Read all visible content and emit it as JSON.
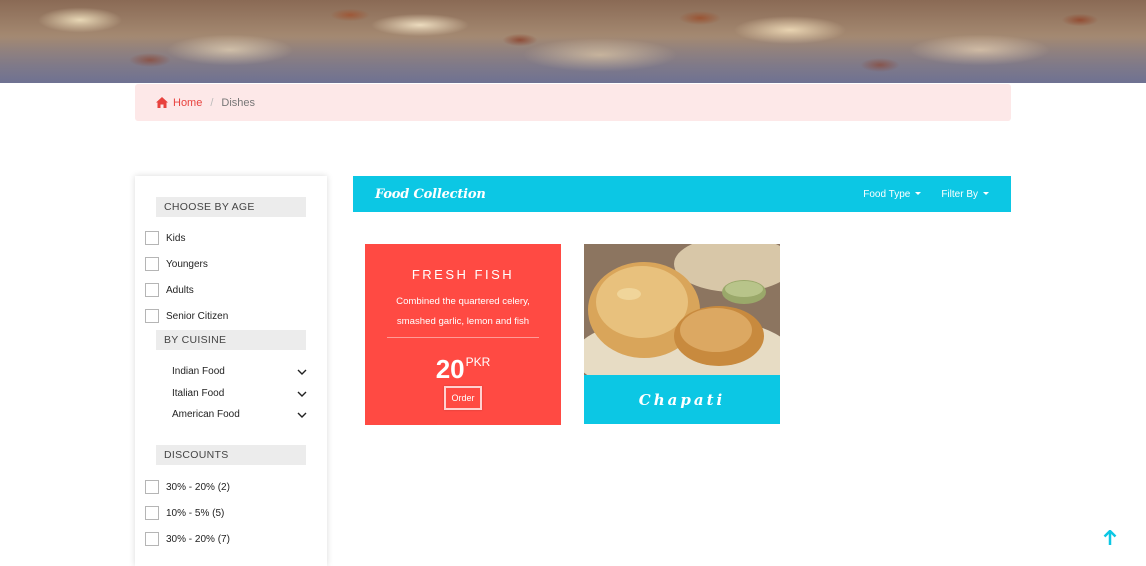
{
  "breadcrumb": {
    "home_label": "Home",
    "current_label": "Dishes"
  },
  "sidebar": {
    "age_heading": "CHOOSE BY AGE",
    "age_options": [
      "Kids",
      "Youngers",
      "Adults",
      "Senior Citizen"
    ],
    "cuisine_heading": "BY CUISINE",
    "cuisine_options": [
      "Indian Food",
      "Italian Food",
      "American Food"
    ],
    "discount_heading": "DISCOUNTS",
    "discount_options": [
      "30% - 20% (2)",
      "10% - 5% (5)",
      "30% - 20% (7)"
    ]
  },
  "collection": {
    "title": "Food Collection",
    "food_type_label": "Food Type",
    "filter_by_label": "Filter By"
  },
  "cards": {
    "fish": {
      "title": "FRESH FISH",
      "description": "Combined the quartered celery, smashed garlic, lemon and fish",
      "price": "20",
      "currency": "PKR",
      "order_label": "Order"
    },
    "chapati": {
      "label": "Chapati"
    }
  },
  "colors": {
    "accent_cyan": "#0cc7e4",
    "accent_red": "#ff4a43",
    "breadcrumb_bg": "#fde8e8"
  },
  "icons": {
    "breadcrumb_home": "home-icon",
    "cuisine_expand": "chevron-down-icon",
    "scroll_top": "arrow-up-icon"
  }
}
